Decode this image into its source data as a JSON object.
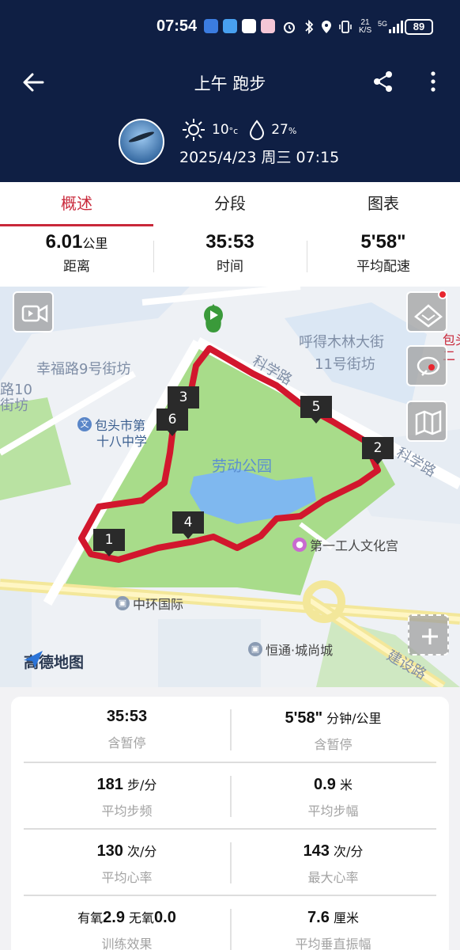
{
  "status_bar": {
    "time": "07:54",
    "net_speed_top": "21",
    "net_speed_bottom": "K/S",
    "network": "5G",
    "battery": "89"
  },
  "header": {
    "title": "上午 跑步",
    "temperature": "10",
    "temp_unit": "°c",
    "humidity": "27",
    "humidity_unit": "%",
    "datetime": "2025/4/23 周三 07:15"
  },
  "tabs": [
    {
      "label": "概述",
      "active": true
    },
    {
      "label": "分段",
      "active": false
    },
    {
      "label": "图表",
      "active": false
    }
  ],
  "summary": {
    "distance_value": "6.01",
    "distance_unit": "公里",
    "distance_label": "距离",
    "time_value": "35:53",
    "time_label": "时间",
    "pace_value": "5'58\"",
    "pace_label": "平均配速"
  },
  "map": {
    "labels": {
      "xingfu_top": "幸福路",
      "xingfu_top2": "街坊",
      "xingfu9": "幸福路9号街坊",
      "hude": "呼得木林大街",
      "hude11": "11号街坊",
      "road_kexue1": "科学路",
      "road_kexue2": "科学路",
      "road10a": "路10",
      "road10b": "街坊",
      "school1": "包头市第",
      "school2": "十八中学",
      "park": "劳动公园",
      "culture": "第一工人文化宫",
      "zhonghuan": "中环国际",
      "hengtong": "恒通·城尚城",
      "jianshe": "建设路",
      "bao_right": "包头",
      "er_right": "二",
      "logo": "高德地图",
      "logo_prefix": "文 幸"
    },
    "laps": [
      "1",
      "2",
      "3",
      "4",
      "5",
      "6"
    ]
  },
  "stats": {
    "rows": [
      [
        {
          "value": "35:53",
          "unit": "",
          "label": "含暂停"
        },
        {
          "value": "5'58\"",
          "unit": " 分钟/公里",
          "label": "含暂停"
        }
      ],
      [
        {
          "value": "181",
          "unit": " 步/分",
          "label": "平均步频"
        },
        {
          "value": "0.9",
          "unit": " 米",
          "label": "平均步幅"
        }
      ],
      [
        {
          "value": "130",
          "unit": " 次/分",
          "label": "平均心率"
        },
        {
          "value": "143",
          "unit": " 次/分",
          "label": "最大心率"
        }
      ],
      [
        {
          "pre1": "有氧",
          "value": "2.9",
          "pre2": " 无氧",
          "value2": "0.0",
          "label": "训练效果"
        },
        {
          "value": "7.6",
          "unit": " 厘米",
          "label": "平均垂直振幅"
        }
      ]
    ]
  },
  "colors": {
    "header_bg": "#0f1f44",
    "accent": "#c9283a",
    "route": "#d2172d",
    "park": "#a8dc8a"
  }
}
